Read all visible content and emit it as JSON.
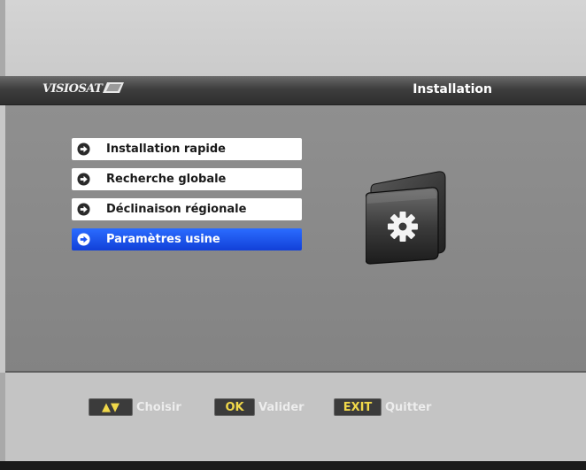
{
  "header": {
    "logo_text": "VISIOSAT",
    "title": "Installation"
  },
  "menu": {
    "items": [
      {
        "label": "Installation rapide",
        "selected": false
      },
      {
        "label": "Recherche globale",
        "selected": false
      },
      {
        "label": "Déclinaison régionale",
        "selected": false
      },
      {
        "label": "Paramètres usine",
        "selected": true
      }
    ]
  },
  "footer": {
    "hints": [
      {
        "key": "▲▼",
        "label": "Choisir"
      },
      {
        "key": "OK",
        "label": "Valider"
      },
      {
        "key": "EXIT",
        "label": "Quitter"
      }
    ]
  },
  "colors": {
    "selected_item": "#1e55f0",
    "key_text": "#f0d84a",
    "title_bar": "#3a3a3a"
  },
  "icons": {
    "menu_bullet": "circle-arrow-right-icon",
    "illustration": "settings-folder-icon"
  }
}
